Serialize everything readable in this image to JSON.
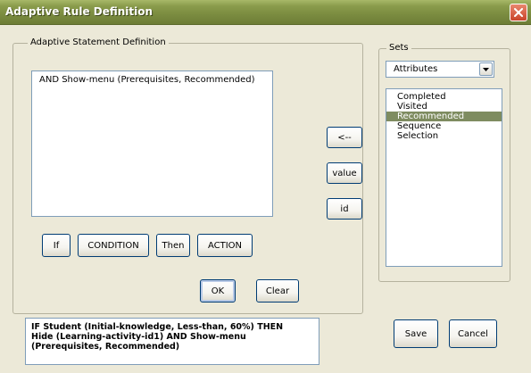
{
  "window": {
    "title": "Adaptive Rule Definition"
  },
  "statement_group": {
    "legend": "Adaptive Statement Definition",
    "statement_text": "AND Show-menu (Prerequisites, Recommended)"
  },
  "clause_buttons": {
    "if": "If",
    "condition": "CONDITION",
    "then": "Then",
    "action": "ACTION"
  },
  "confirm_buttons": {
    "ok": "OK",
    "clear": "Clear"
  },
  "middle_buttons": {
    "arrow": "<--",
    "value": "value",
    "id": "id"
  },
  "sets": {
    "legend": "Sets",
    "dropdown_selected": "Attributes",
    "items": [
      "Completed",
      "Visited",
      "Recommended",
      "Sequence",
      "Selection"
    ],
    "selected_item": "Recommended"
  },
  "rule_output": "IF Student (Initial-knowledge, Less-than, 60%) THEN\nHide (Learning-activity-id1) AND Show-menu\n(Prerequisites, Recommended)",
  "dialog_buttons": {
    "save": "Save",
    "cancel": "Cancel"
  },
  "colors": {
    "titlebar": "#7b8c40",
    "selection": "#7e8c60",
    "face": "#ece9d8"
  }
}
